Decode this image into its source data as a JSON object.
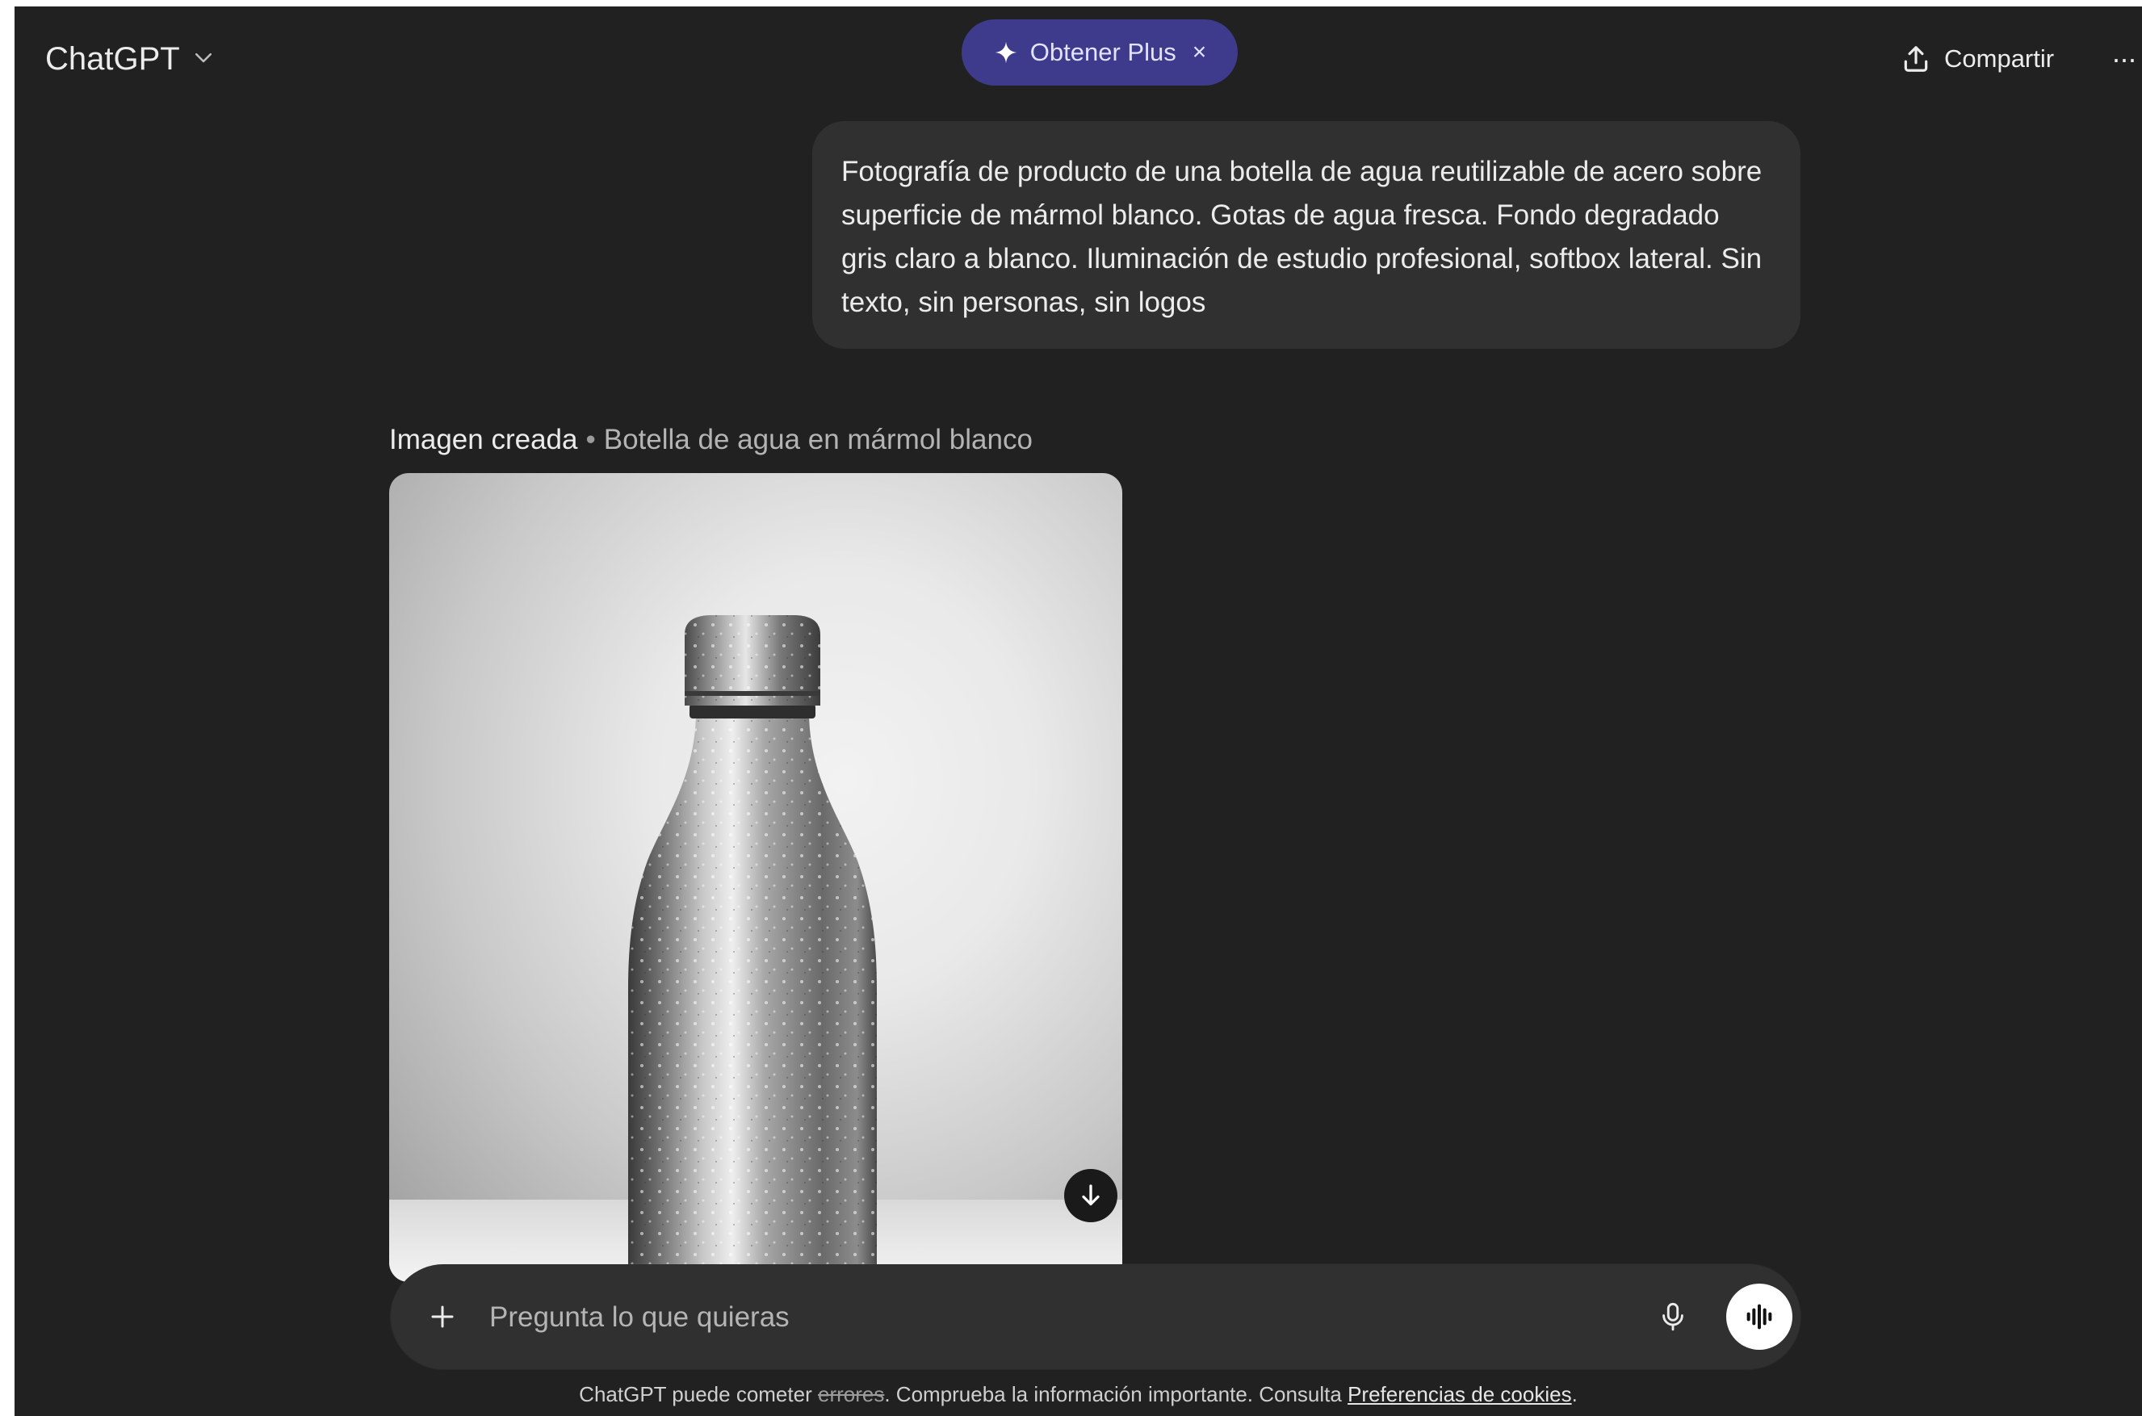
{
  "header": {
    "model_name": "ChatGPT",
    "upgrade_label": "Obtener Plus",
    "upgrade_close": "×",
    "share_label": "Compartir",
    "more_label": "···"
  },
  "conversation": {
    "user_message": "Fotografía de producto de una botella de agua reutilizable de acero sobre superficie de mármol blanco. Gotas de agua fresca. Fondo degradado gris claro a blanco. Iluminación de estudio profesional, softbox lateral. Sin texto, sin personas, sin logos",
    "image_label": "Imagen creada",
    "image_separator": "•",
    "image_title": "Botella de agua en mármol blanco"
  },
  "composer": {
    "placeholder": "Pregunta lo que quieras"
  },
  "footer": {
    "prefix": "ChatGPT puede cometer",
    "struck_word": "errores",
    "middle": ". Comprueba la información importante. Consulta",
    "link_text": "Preferencias de cookies",
    "suffix": "."
  },
  "icons": {
    "model_dropdown": "chevron-down-icon",
    "upgrade": "sparkle-icon",
    "share": "share-upload-icon",
    "more": "more-horizontal-icon",
    "download": "arrow-down-icon",
    "add": "plus-icon",
    "mic": "microphone-icon",
    "voice": "voice-waveform-icon"
  },
  "colors": {
    "background": "#212121",
    "bubble": "#303030",
    "upgrade_pill": "#3e3a8c",
    "text": "#ececec"
  }
}
